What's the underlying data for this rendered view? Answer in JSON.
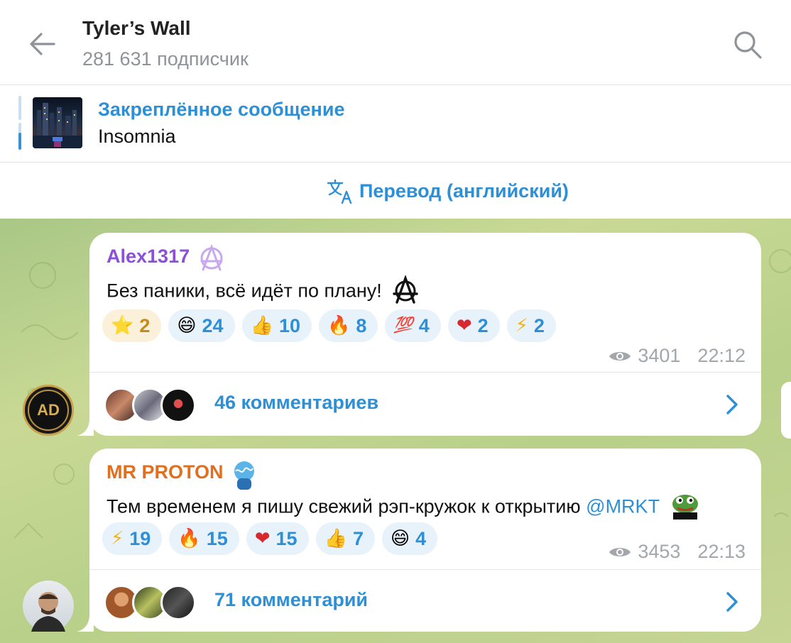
{
  "header": {
    "title": "Tyler’s Wall",
    "subtitle": "281 631 подписчик"
  },
  "pinned": {
    "label": "Закреплённое сообщение",
    "text": "Insomnia"
  },
  "translate": {
    "label": "Перевод (английский)"
  },
  "posts": [
    {
      "author": "Alex1317",
      "author_color": "#8c4fd8",
      "text": "Без паники, всё идёт по плану!",
      "reactions": [
        {
          "emoji": "⭐",
          "count": "2",
          "active": true
        },
        {
          "emoji": "😄",
          "count": "24"
        },
        {
          "emoji": "👍",
          "count": "10"
        },
        {
          "emoji": "🔥",
          "count": "8"
        },
        {
          "emoji": "💯",
          "count": "4"
        },
        {
          "emoji": "❤",
          "count": "2"
        },
        {
          "emoji": "⚡",
          "count": "2"
        }
      ],
      "views": "3401",
      "time": "22:12",
      "comments": "46 комментариев"
    },
    {
      "author": "MR PROTON",
      "author_color": "#e0701f",
      "text": "Тем временем я пишу свежий рэп-кружок к открытию",
      "mention": "@MRKT",
      "reactions": [
        {
          "emoji": "⚡",
          "count": "19"
        },
        {
          "emoji": "🔥",
          "count": "15"
        },
        {
          "emoji": "❤",
          "count": "15"
        },
        {
          "emoji": "👍",
          "count": "7"
        },
        {
          "emoji": "😄",
          "count": "4"
        }
      ],
      "views": "3453",
      "time": "22:13",
      "comments": "71 комментарий"
    }
  ],
  "colors": {
    "accent": "#2d8fd6",
    "chat_bg": "#b8d08a"
  }
}
